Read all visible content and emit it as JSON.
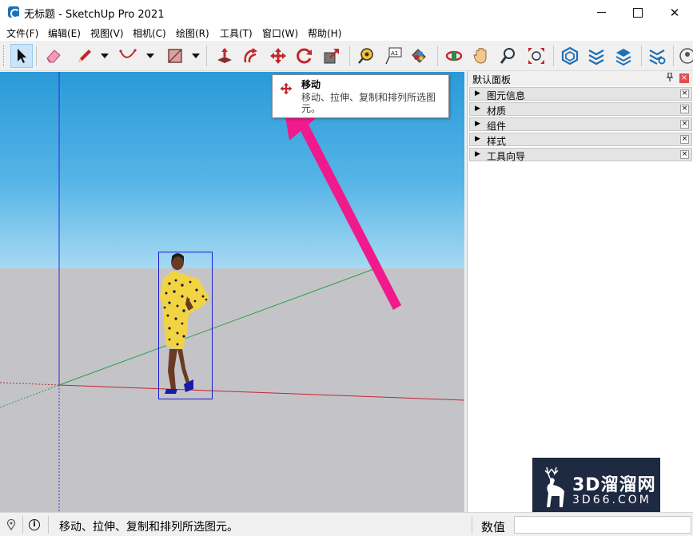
{
  "window": {
    "title": "无标题 - SketchUp Pro 2021",
    "minimize_icon": "minimize-icon",
    "maximize_icon": "maximize-icon",
    "close_label": "✕"
  },
  "menu": {
    "items": [
      {
        "label": "文件(F)"
      },
      {
        "label": "编辑(E)"
      },
      {
        "label": "视图(V)"
      },
      {
        "label": "相机(C)"
      },
      {
        "label": "绘图(R)"
      },
      {
        "label": "工具(T)"
      },
      {
        "label": "窗口(W)"
      },
      {
        "label": "帮助(H)"
      }
    ]
  },
  "toolbar": {
    "tools": [
      {
        "icon": "select-arrow-icon",
        "active": true
      },
      {
        "icon": "eraser-icon"
      },
      {
        "icon": "pencil-line-icon"
      },
      {
        "icon": "arc-icon"
      },
      {
        "icon": "rectangle-icon"
      },
      {
        "icon": "push-pull-icon"
      },
      {
        "icon": "offset-icon"
      },
      {
        "icon": "move-icon"
      },
      {
        "icon": "rotate-icon"
      },
      {
        "icon": "scale-icon"
      },
      {
        "icon": "tape-measure-icon"
      },
      {
        "icon": "text-label-icon"
      },
      {
        "icon": "paint-bucket-icon"
      },
      {
        "icon": "orbit-icon"
      },
      {
        "icon": "pan-hand-icon"
      },
      {
        "icon": "zoom-icon"
      },
      {
        "icon": "zoom-extents-icon"
      },
      {
        "icon": "warehouse-icon"
      },
      {
        "icon": "extension-warehouse-icon"
      },
      {
        "icon": "layout-icon"
      },
      {
        "icon": "extension-manager-icon"
      },
      {
        "icon": "profile-icon"
      }
    ],
    "text_tool_label": "A1"
  },
  "tooltip": {
    "title": "移动",
    "description": "移动、拉伸、复制和排列所选图元。",
    "icon": "move-icon"
  },
  "tray": {
    "title": "默认面板",
    "pin_icon": "pin-icon",
    "close_label": "×",
    "panels": [
      {
        "label": "图元信息"
      },
      {
        "label": "材质"
      },
      {
        "label": "组件"
      },
      {
        "label": "样式"
      },
      {
        "label": "工具向导"
      }
    ],
    "panel_close_label": "×",
    "panel_expand_glyph": "▶"
  },
  "viewport": {
    "sky_color": "#3aa6de",
    "ground_color": "#c4c4c8",
    "axis_colors": {
      "red": "#c0282d",
      "green": "#2ea043",
      "blue": "#2a2ad6"
    },
    "selection_color": "#1a1acf",
    "annotation_arrow_color": "#f01a8c",
    "model": "person-figure"
  },
  "watermark": {
    "line1": "3D溜溜网",
    "line2": "3D66.COM",
    "logo": "deer-logo"
  },
  "statusbar": {
    "info_label": "i",
    "status_text": "移动、拉伸、复制和排列所选图元。",
    "measurements_label": "数值",
    "measurements_value": ""
  }
}
